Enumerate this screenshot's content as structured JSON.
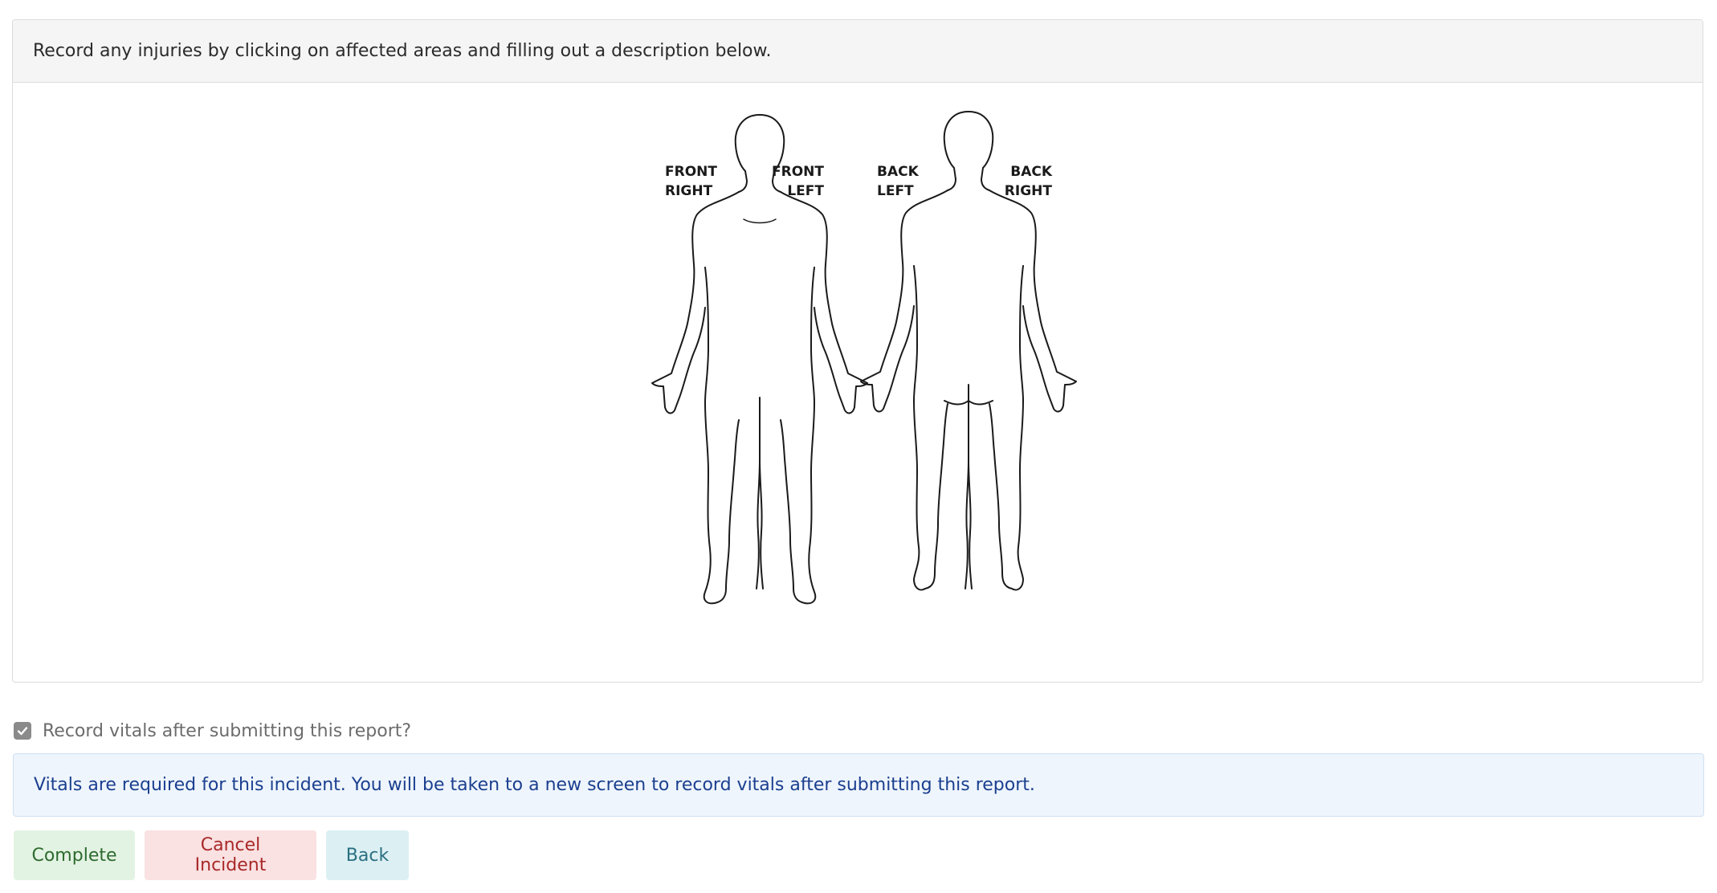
{
  "card": {
    "instructions": "Record any injuries by clicking on affected areas and filling out a description below."
  },
  "body_diagram": {
    "labels": {
      "front_right_1": "FRONT",
      "front_right_2": "RIGHT",
      "front_left_1": "FRONT",
      "front_left_2": "LEFT",
      "back_left_1": "BACK",
      "back_left_2": "LEFT",
      "back_right_1": "BACK",
      "back_right_2": "RIGHT"
    }
  },
  "vitals": {
    "checkbox_label": "Record vitals after submitting this report?",
    "checked": true,
    "notice": "Vitals are required for this incident. You will be taken to a new screen to record vitals after submitting this report."
  },
  "actions": {
    "complete_label": "Complete",
    "cancel_label": "Cancel Incident",
    "back_label": "Back"
  },
  "colors": {
    "complete_bg": "#e3f3e3",
    "cancel_bg": "#fae1e2",
    "back_bg": "#dcf0f4",
    "notice_bg": "#eef5fc",
    "notice_text": "#1b3f8f"
  }
}
